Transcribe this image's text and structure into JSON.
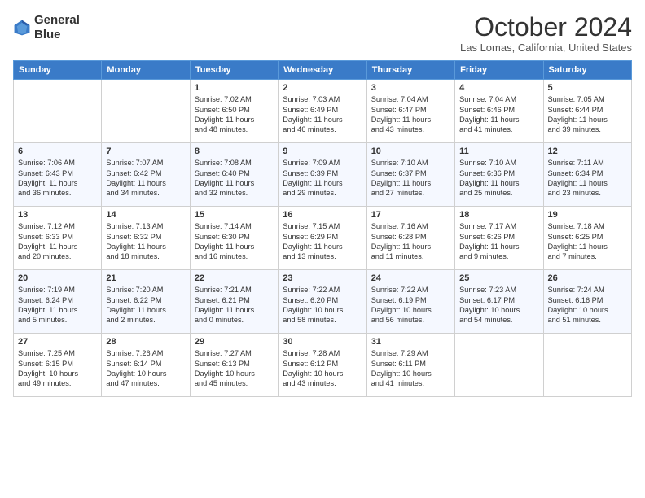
{
  "header": {
    "logo": {
      "line1": "General",
      "line2": "Blue"
    },
    "title": "October 2024",
    "location": "Las Lomas, California, United States"
  },
  "weekdays": [
    "Sunday",
    "Monday",
    "Tuesday",
    "Wednesday",
    "Thursday",
    "Friday",
    "Saturday"
  ],
  "weeks": [
    [
      {
        "day": "",
        "info": ""
      },
      {
        "day": "",
        "info": ""
      },
      {
        "day": "1",
        "info": "Sunrise: 7:02 AM\nSunset: 6:50 PM\nDaylight: 11 hours\nand 48 minutes."
      },
      {
        "day": "2",
        "info": "Sunrise: 7:03 AM\nSunset: 6:49 PM\nDaylight: 11 hours\nand 46 minutes."
      },
      {
        "day": "3",
        "info": "Sunrise: 7:04 AM\nSunset: 6:47 PM\nDaylight: 11 hours\nand 43 minutes."
      },
      {
        "day": "4",
        "info": "Sunrise: 7:04 AM\nSunset: 6:46 PM\nDaylight: 11 hours\nand 41 minutes."
      },
      {
        "day": "5",
        "info": "Sunrise: 7:05 AM\nSunset: 6:44 PM\nDaylight: 11 hours\nand 39 minutes."
      }
    ],
    [
      {
        "day": "6",
        "info": "Sunrise: 7:06 AM\nSunset: 6:43 PM\nDaylight: 11 hours\nand 36 minutes."
      },
      {
        "day": "7",
        "info": "Sunrise: 7:07 AM\nSunset: 6:42 PM\nDaylight: 11 hours\nand 34 minutes."
      },
      {
        "day": "8",
        "info": "Sunrise: 7:08 AM\nSunset: 6:40 PM\nDaylight: 11 hours\nand 32 minutes."
      },
      {
        "day": "9",
        "info": "Sunrise: 7:09 AM\nSunset: 6:39 PM\nDaylight: 11 hours\nand 29 minutes."
      },
      {
        "day": "10",
        "info": "Sunrise: 7:10 AM\nSunset: 6:37 PM\nDaylight: 11 hours\nand 27 minutes."
      },
      {
        "day": "11",
        "info": "Sunrise: 7:10 AM\nSunset: 6:36 PM\nDaylight: 11 hours\nand 25 minutes."
      },
      {
        "day": "12",
        "info": "Sunrise: 7:11 AM\nSunset: 6:34 PM\nDaylight: 11 hours\nand 23 minutes."
      }
    ],
    [
      {
        "day": "13",
        "info": "Sunrise: 7:12 AM\nSunset: 6:33 PM\nDaylight: 11 hours\nand 20 minutes."
      },
      {
        "day": "14",
        "info": "Sunrise: 7:13 AM\nSunset: 6:32 PM\nDaylight: 11 hours\nand 18 minutes."
      },
      {
        "day": "15",
        "info": "Sunrise: 7:14 AM\nSunset: 6:30 PM\nDaylight: 11 hours\nand 16 minutes."
      },
      {
        "day": "16",
        "info": "Sunrise: 7:15 AM\nSunset: 6:29 PM\nDaylight: 11 hours\nand 13 minutes."
      },
      {
        "day": "17",
        "info": "Sunrise: 7:16 AM\nSunset: 6:28 PM\nDaylight: 11 hours\nand 11 minutes."
      },
      {
        "day": "18",
        "info": "Sunrise: 7:17 AM\nSunset: 6:26 PM\nDaylight: 11 hours\nand 9 minutes."
      },
      {
        "day": "19",
        "info": "Sunrise: 7:18 AM\nSunset: 6:25 PM\nDaylight: 11 hours\nand 7 minutes."
      }
    ],
    [
      {
        "day": "20",
        "info": "Sunrise: 7:19 AM\nSunset: 6:24 PM\nDaylight: 11 hours\nand 5 minutes."
      },
      {
        "day": "21",
        "info": "Sunrise: 7:20 AM\nSunset: 6:22 PM\nDaylight: 11 hours\nand 2 minutes."
      },
      {
        "day": "22",
        "info": "Sunrise: 7:21 AM\nSunset: 6:21 PM\nDaylight: 11 hours\nand 0 minutes."
      },
      {
        "day": "23",
        "info": "Sunrise: 7:22 AM\nSunset: 6:20 PM\nDaylight: 10 hours\nand 58 minutes."
      },
      {
        "day": "24",
        "info": "Sunrise: 7:22 AM\nSunset: 6:19 PM\nDaylight: 10 hours\nand 56 minutes."
      },
      {
        "day": "25",
        "info": "Sunrise: 7:23 AM\nSunset: 6:17 PM\nDaylight: 10 hours\nand 54 minutes."
      },
      {
        "day": "26",
        "info": "Sunrise: 7:24 AM\nSunset: 6:16 PM\nDaylight: 10 hours\nand 51 minutes."
      }
    ],
    [
      {
        "day": "27",
        "info": "Sunrise: 7:25 AM\nSunset: 6:15 PM\nDaylight: 10 hours\nand 49 minutes."
      },
      {
        "day": "28",
        "info": "Sunrise: 7:26 AM\nSunset: 6:14 PM\nDaylight: 10 hours\nand 47 minutes."
      },
      {
        "day": "29",
        "info": "Sunrise: 7:27 AM\nSunset: 6:13 PM\nDaylight: 10 hours\nand 45 minutes."
      },
      {
        "day": "30",
        "info": "Sunrise: 7:28 AM\nSunset: 6:12 PM\nDaylight: 10 hours\nand 43 minutes."
      },
      {
        "day": "31",
        "info": "Sunrise: 7:29 AM\nSunset: 6:11 PM\nDaylight: 10 hours\nand 41 minutes."
      },
      {
        "day": "",
        "info": ""
      },
      {
        "day": "",
        "info": ""
      }
    ]
  ]
}
